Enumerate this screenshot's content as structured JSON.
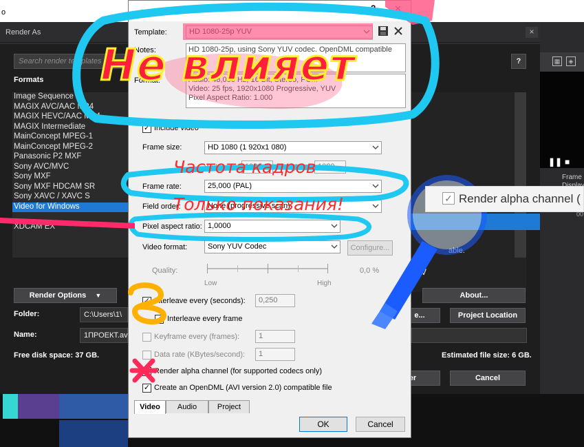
{
  "top_strip": {
    "label": "o"
  },
  "render_as": {
    "title": "Render As",
    "close": "×",
    "search_placeholder": "Search render templates",
    "help": "?",
    "formats_label": "Formats",
    "formats": [
      "Image Sequence",
      "MAGIX AVC/AAC MP4",
      "MAGIX HEVC/AAC MP4",
      "MAGIX Intermediate",
      "MainConcept MPEG-1",
      "MainConcept MPEG-2",
      "Panasonic P2 MXF",
      "Sony AVC/MVC",
      "Sony MXF",
      "Sony MXF HDCAM SR",
      "Sony XAVC / XAVC S",
      "Video for Windows",
      "",
      "XDCAM EX"
    ],
    "selected_format_index": 11,
    "render_options": "Render Options",
    "folder_label": "Folder:",
    "folder_value": "C:\\Users\\1\\",
    "name_label": "Name:",
    "name_value": "1ПРОЕКТ.avi",
    "free_disk": "Free disk space: 37 GB.",
    "about": "About...",
    "project_location": "Project Location",
    "browse_partial": "e...",
    "estimated": "Estimated file size: 6 GB.",
    "render_partial": "er",
    "cancel": "Cancel",
    "able_partial": "able.",
    "right_partial": "V"
  },
  "video_preview": {
    "frame_label": "Frame",
    "display_label": "Display",
    "ruler": "00"
  },
  "dialog": {
    "title_help": "?",
    "title_close": "✕",
    "template_label": "Template:",
    "template_value": "HD 1080-25p YUV",
    "notes_label": "Notes:",
    "notes_text": "HD 1080-25p, using Sony YUV codec. OpenDML compatible",
    "format_label": "Format:",
    "format_lines": [
      "Audio: 48,000 Hz, 16 Bit, Stereo, PCM",
      "Video: 25 fps, 1920x1080 Progressive, YUV",
      "Pixel Aspect Ratio: 1.000"
    ],
    "include_video": "Include video",
    "frame_size_label": "Frame size:",
    "frame_size_value": "HD 1080 (1 920x1 080)",
    "width_label": "Width:",
    "width_value": "1920",
    "height_label": "Height:",
    "height_value": "1080",
    "frame_rate_label": "Frame rate:",
    "frame_rate_value": "25,000 (PAL)",
    "field_order_label": "Field order:",
    "field_order_value": "None (progressive scan)",
    "par_label": "Pixel aspect ratio:",
    "par_value": "1,0000",
    "video_format_label": "Video format:",
    "video_format_value": "Sony YUV Codec",
    "configure": "Configure...",
    "quality_label": "Quality:",
    "quality_low": "Low",
    "quality_high": "High",
    "quality_value": "0,0 %",
    "interleave_seconds_label": "Interleave every (seconds):",
    "interleave_seconds_value": "0,250",
    "interleave_frame_label": "Interleave every frame",
    "keyframe_label": "Keyframe every (frames):",
    "keyframe_value": "1",
    "data_rate_label": "Data rate (KBytes/second):",
    "data_rate_value": "1",
    "render_alpha_label": "Render alpha channel (for supported codecs only)",
    "opendml_label": "Create an OpenDML (AVI version 2.0) compatible file",
    "tabs": [
      "Video",
      "Audio",
      "Project"
    ],
    "ok": "OK",
    "cancel": "Cancel"
  },
  "annotations": {
    "big_text": "Не влияет",
    "frame_rate_note": "Частота кадров",
    "readonly_note": "Только показания!",
    "popup_text": "Render alpha channel (",
    "yellow_mark": "8",
    "red_mark": "*",
    "colors": {
      "cyan": "#1ec8f0",
      "pink": "#ff5c8a",
      "red": "#ff2a2a",
      "yellow": "#ffb000",
      "blue": "#1a5cff"
    }
  }
}
